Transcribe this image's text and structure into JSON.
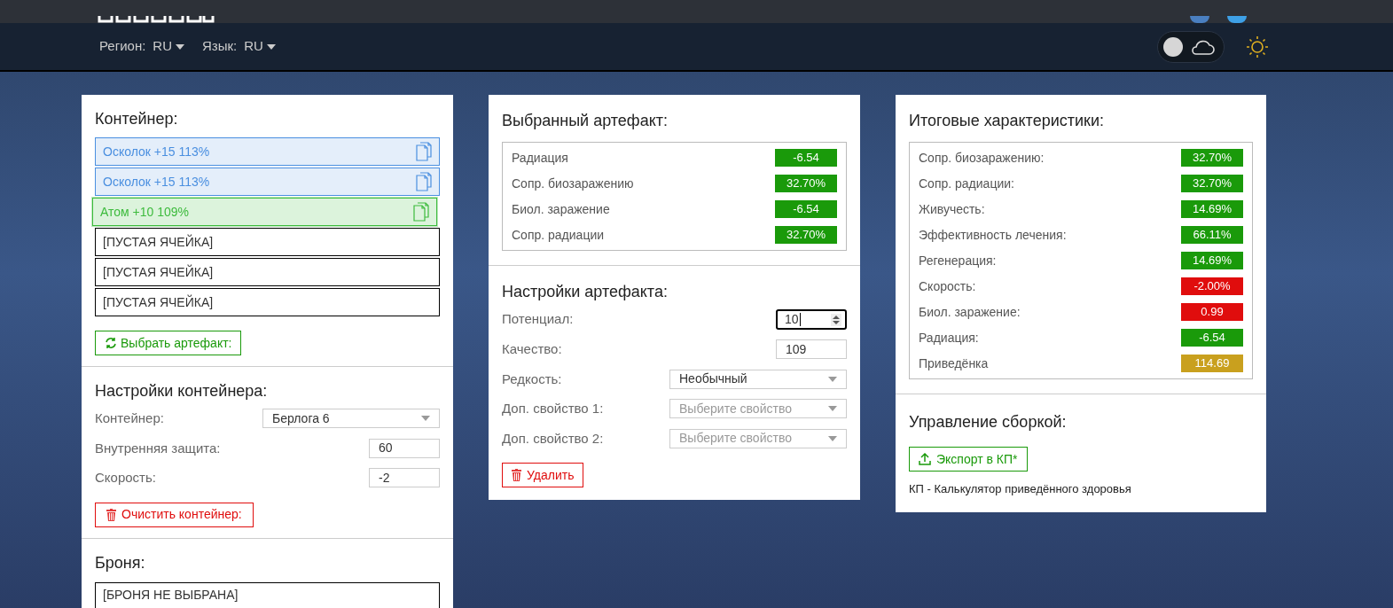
{
  "header": {
    "region_label": "Регион:",
    "region_value": "RU",
    "language_label": "Язык:",
    "language_value": "RU",
    "theme_toggle": {
      "on": false
    }
  },
  "container_panel": {
    "title": "Контейнер:",
    "slots": [
      {
        "label": "Осколок +15 113%",
        "kind": "artifact",
        "color": "#4a8fe0",
        "selected": false
      },
      {
        "label": "Осколок +15 113%",
        "kind": "artifact",
        "color": "#4a8fe0",
        "selected": false
      },
      {
        "label": "Атом +10 109%",
        "kind": "artifact",
        "color": "#3dbb3d",
        "selected": true
      },
      {
        "label": "[ПУСТАЯ ЯЧЕЙКА]",
        "kind": "empty",
        "selected": false
      },
      {
        "label": "[ПУСТАЯ ЯЧЕЙКА]",
        "kind": "empty",
        "selected": false
      },
      {
        "label": "[ПУСТАЯ ЯЧЕЙКА]",
        "kind": "empty",
        "selected": false
      }
    ],
    "choose_button": "Выбрать артефакт:",
    "settings_title": "Настройки контейнера:",
    "fields": [
      {
        "label": "Контейнер:",
        "kind": "select",
        "value": "Берлога 6"
      },
      {
        "label": "Внутренняя защита:",
        "kind": "input",
        "value": "60"
      },
      {
        "label": "Скорость:",
        "kind": "input",
        "value": "-2"
      }
    ],
    "clear_button": "Очистить контейнер:",
    "armor_title": "Броня:",
    "armor_slot": "[БРОНЯ НЕ ВЫБРАНА]"
  },
  "artifact_panel": {
    "title": "Выбранный артефакт:",
    "stats": [
      {
        "name": "Радиация",
        "value": "-6.54",
        "color": "#1a9a0a"
      },
      {
        "name": "Сопр. биозаражению",
        "value": "32.70%",
        "color": "#1a9a0a"
      },
      {
        "name": "Биол. заражение",
        "value": "-6.54",
        "color": "#1a9a0a"
      },
      {
        "name": "Сопр. радиации",
        "value": "32.70%",
        "color": "#1a9a0a"
      }
    ],
    "settings_title": "Настройки артефакта:",
    "fields": [
      {
        "label": "Потенциал:",
        "kind": "spinner",
        "value": "10"
      },
      {
        "label": "Качество:",
        "kind": "input",
        "value": "109"
      },
      {
        "label": "Редкость:",
        "kind": "select",
        "value": "Необычный"
      },
      {
        "label": "Доп. свойство 1:",
        "kind": "select",
        "placeholder": "Выберите свойство"
      },
      {
        "label": "Доп. свойство 2:",
        "kind": "select",
        "placeholder": "Выберите свойство"
      }
    ],
    "delete_button": "Удалить"
  },
  "totals_panel": {
    "title": "Итоговые характеристики:",
    "stats": [
      {
        "name": "Сопр. биозаражению:",
        "value": "32.70%",
        "color": "#1a9a0a"
      },
      {
        "name": "Сопр. радиации:",
        "value": "32.70%",
        "color": "#1a9a0a"
      },
      {
        "name": "Живучесть:",
        "value": "14.69%",
        "color": "#1a9a0a"
      },
      {
        "name": "Эффективность лечения:",
        "value": "66.11%",
        "color": "#1a9a0a"
      },
      {
        "name": "Регенерация:",
        "value": "14.69%",
        "color": "#1a9a0a"
      },
      {
        "name": "Скорость:",
        "value": "-2.00%",
        "color": "#e00d0d"
      },
      {
        "name": "Биол. заражение:",
        "value": "0.99",
        "color": "#e00d0d"
      },
      {
        "name": "Радиация:",
        "value": "-6.54",
        "color": "#1a9a0a"
      },
      {
        "name": "Приведёнка",
        "value": "114.69",
        "color": "#c9a01e"
      }
    ],
    "build_title": "Управление сборкой:",
    "export_button": "Экспорт в КП*",
    "note": "КП - Калькулятор приведённого здоровья"
  }
}
